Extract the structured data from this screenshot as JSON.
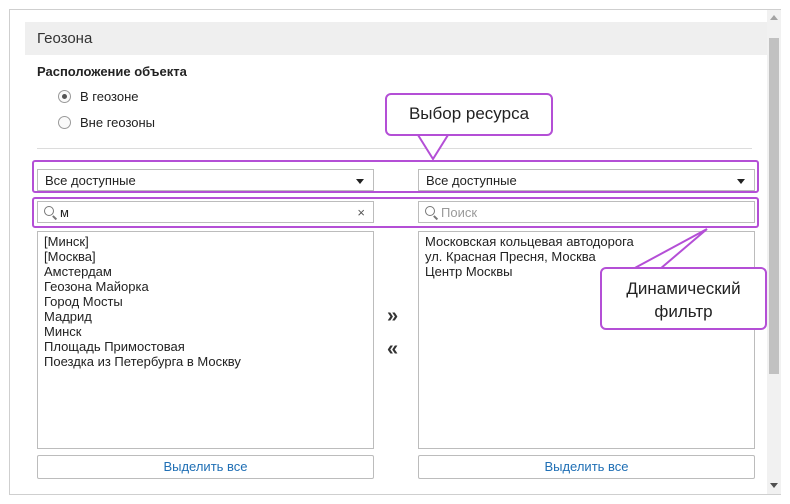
{
  "section": {
    "title": "Геозона"
  },
  "location": {
    "label": "Расположение объекта",
    "options": [
      {
        "label": "В геозоне",
        "checked": true
      },
      {
        "label": "Вне геозоны",
        "checked": false
      }
    ]
  },
  "left_panel": {
    "select_value": "Все доступные",
    "search_value": "м",
    "clear_symbol": "×",
    "items": [
      "[Минск]",
      "[Москва]",
      "Амстердам",
      "Геозона Майорка",
      "Город Мосты",
      "Мадрид",
      "Минск",
      "Площадь Примостовая",
      "Поездка из Петербурга в Москву"
    ],
    "select_all_label": "Выделить все"
  },
  "right_panel": {
    "select_value": "Все доступные",
    "search_placeholder": "Поиск",
    "items": [
      "Московская кольцевая автодорога",
      "ул. Красная Пресня, Москва",
      "Центр Москвы"
    ],
    "select_all_label": "Выделить все"
  },
  "transfer": {
    "move_right": "»",
    "move_left": "«"
  },
  "annotations": {
    "resource_choice": "Выбор ресурса",
    "dynamic_filter_line1": "Динамический",
    "dynamic_filter_line2": "фильтр",
    "color": "#b44fd6"
  },
  "colors": {
    "link": "#1f6fb5",
    "header_bg": "#efefef"
  }
}
